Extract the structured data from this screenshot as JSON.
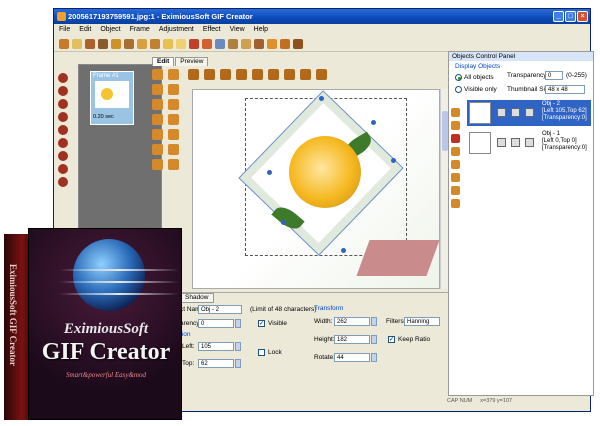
{
  "window": {
    "title": "2005617193759591.jpg:1 - EximiousSoft GIF Creator",
    "controls": [
      "_",
      "□",
      "×"
    ]
  },
  "menu": [
    "File",
    "Edit",
    "Object",
    "Frame",
    "Adjustment",
    "Effect",
    "View",
    "Help"
  ],
  "frames_panel": {
    "frame_label": "Frame #1",
    "frame_delay": "0.20 sec"
  },
  "editor": {
    "tabs": [
      "Edit",
      "Preview"
    ]
  },
  "object_panel": {
    "title": "Objects Control Panel",
    "display_objects_label": "Display Objects",
    "all_objects": "All objects",
    "visible_only": "Visible only",
    "transparency_label": "Transparency:",
    "transparency_value": "0",
    "transparency_range": "(0-255)",
    "thumb_size_label": "Thumbnail Size:",
    "thumb_size_value": "48 x 48",
    "items": [
      {
        "name": "Obj - 2",
        "pos": "[Left 105,Top 62]",
        "trans": "[Transparency:0]"
      },
      {
        "name": "Obj - 1",
        "pos": "[Left 0,Top 0]",
        "trans": "[Transparency:0]"
      }
    ]
  },
  "properties": {
    "shadow_tab": "Shadow",
    "name_label": "ct Name:",
    "name_value": "Obj - 2",
    "name_limit": "(Limit of 48 characters)",
    "transparency_label": "arency:",
    "transparency_value": "0",
    "visible_label": "Visible",
    "position_label": "tion",
    "left_label": "Left:",
    "left_value": "105",
    "top_label": "Top:",
    "top_value": "62",
    "lock_label": "Lock",
    "transform_label": "Transform",
    "width_label": "Width:",
    "width_value": "262",
    "height_label": "Height:",
    "height_value": "182",
    "rotate_label": "Rotate:",
    "rotate_value": "44",
    "filters_label": "Filters:",
    "filters_value": "Hanning",
    "keep_ratio_label": "Keep Ratio"
  },
  "status": {
    "caps": "CAP NUM",
    "coords": "x=379 y=107"
  },
  "box": {
    "spine_text": "EximiousSoft GIF Creator",
    "brand_top": "EximiousSoft",
    "brand_main": "GIF Creator",
    "tagline": "Smart&powerful   Easy&mod"
  },
  "colors": {
    "titlebar": "#0d4ab8",
    "selection": "#2f63c4",
    "box_bg": "#1a0a1a"
  }
}
